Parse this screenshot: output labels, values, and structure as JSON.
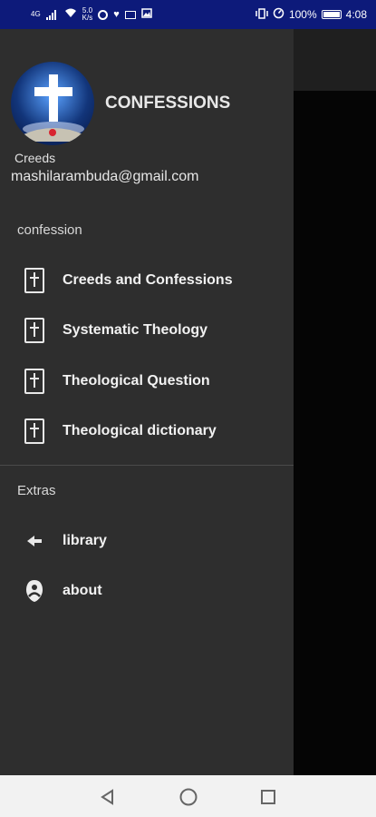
{
  "status_bar": {
    "net_type": "4G",
    "speed_value": "5.0",
    "speed_unit": "K/s",
    "battery_pct": "100%",
    "time": "4:08"
  },
  "drawer": {
    "app_title": "CONFESSIONS",
    "subtitle": "Creeds",
    "email": "mashilarambuda@gmail.com",
    "section_confession": "confession",
    "confession_items": [
      {
        "label": "Creeds and Confessions",
        "icon": "book-icon"
      },
      {
        "label": "Systematic Theology",
        "icon": "book-icon"
      },
      {
        "label": "Theological Question",
        "icon": "book-icon"
      },
      {
        "label": "Theological dictionary",
        "icon": "book-icon"
      }
    ],
    "section_extras": "Extras",
    "extras_items": [
      {
        "label": "library",
        "icon": "share-icon"
      },
      {
        "label": "about",
        "icon": "about-icon"
      }
    ]
  },
  "colors": {
    "status_bar": "#0d1a7a",
    "drawer_bg": "#2e2e2e",
    "nav_bar": "#f2f2f2"
  }
}
